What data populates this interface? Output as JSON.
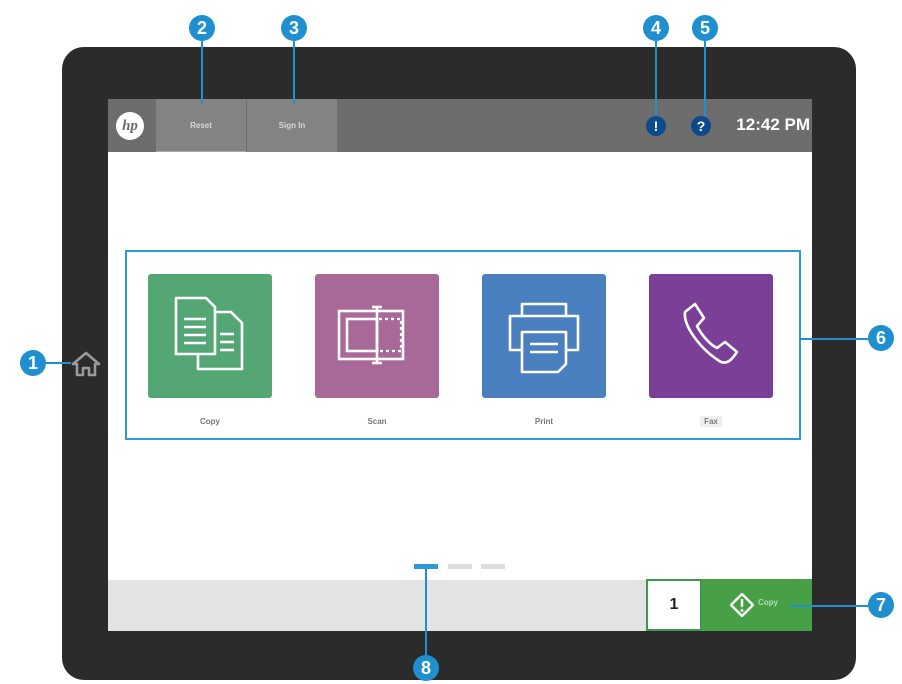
{
  "topbar": {
    "logo": "hp",
    "reset_label": "Reset",
    "signin_label": "Sign In",
    "alert_icon": "!",
    "help_icon": "?",
    "time": "12:42 PM"
  },
  "apps": [
    {
      "label": "Copy",
      "color": "#54a675",
      "icon": "copy-icon"
    },
    {
      "label": "Scan",
      "color": "#a86898",
      "icon": "scan-icon"
    },
    {
      "label": "Print",
      "color": "#4a7fc0",
      "icon": "print-icon"
    },
    {
      "label": "Fax",
      "color": "#7b3f98",
      "icon": "phone-icon"
    }
  ],
  "pagination": {
    "pages": 3,
    "current": 1
  },
  "bottom": {
    "copies": "1",
    "start_label": "Copy"
  },
  "callouts": [
    "1",
    "2",
    "3",
    "4",
    "5",
    "6",
    "7",
    "8"
  ],
  "colors": {
    "accent": "#1f8fd0",
    "start": "#47a046",
    "topbar": "#6d6d6d"
  }
}
